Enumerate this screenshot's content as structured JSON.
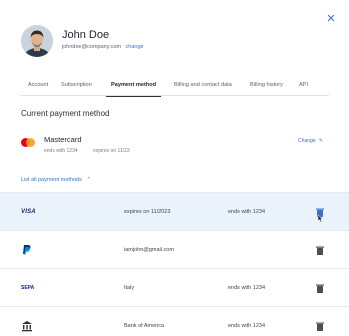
{
  "user": {
    "name": "John Doe",
    "email": "johndoe@company.com",
    "change_label": "change"
  },
  "tabs": [
    {
      "label": "Account",
      "active": false
    },
    {
      "label": "Subscription",
      "active": false
    },
    {
      "label": "Payment method",
      "active": true
    },
    {
      "label": "Billing and contact data",
      "active": false
    },
    {
      "label": "Billing history",
      "active": false
    },
    {
      "label": "API",
      "active": false
    }
  ],
  "current": {
    "title": "Current payment method",
    "card_name": "Mastercard",
    "card_ending": "ends with 1234",
    "card_expires": "expires on 11/23",
    "change_label": "Change"
  },
  "list_link_label": "List all payment methods",
  "methods": [
    {
      "logo": "visa",
      "logo_text": "VISA",
      "col2": "expires on 11/2023",
      "col3": "ends with 1234",
      "highlighted": true
    },
    {
      "logo": "paypal",
      "logo_text": "PayPal",
      "col2": "iamjohn@gmail.com",
      "col3": "",
      "highlighted": false
    },
    {
      "logo": "sepa",
      "logo_text": "SEPA",
      "col2": "Italy",
      "col3": "ends with 1234",
      "highlighted": false
    },
    {
      "logo": "bank",
      "logo_text": "",
      "col2": "Bank of America",
      "col3": "ends with 1234",
      "highlighted": false
    }
  ],
  "icons": {
    "close": "close-icon",
    "edit": "pencil-icon",
    "chevron": "chevron-up-icon",
    "trash": "trash-icon",
    "bank": "bank-icon"
  },
  "colors": {
    "accent": "#3b6fd4",
    "highlight_row": "#eaf3fc",
    "text": "#2b2f36"
  }
}
